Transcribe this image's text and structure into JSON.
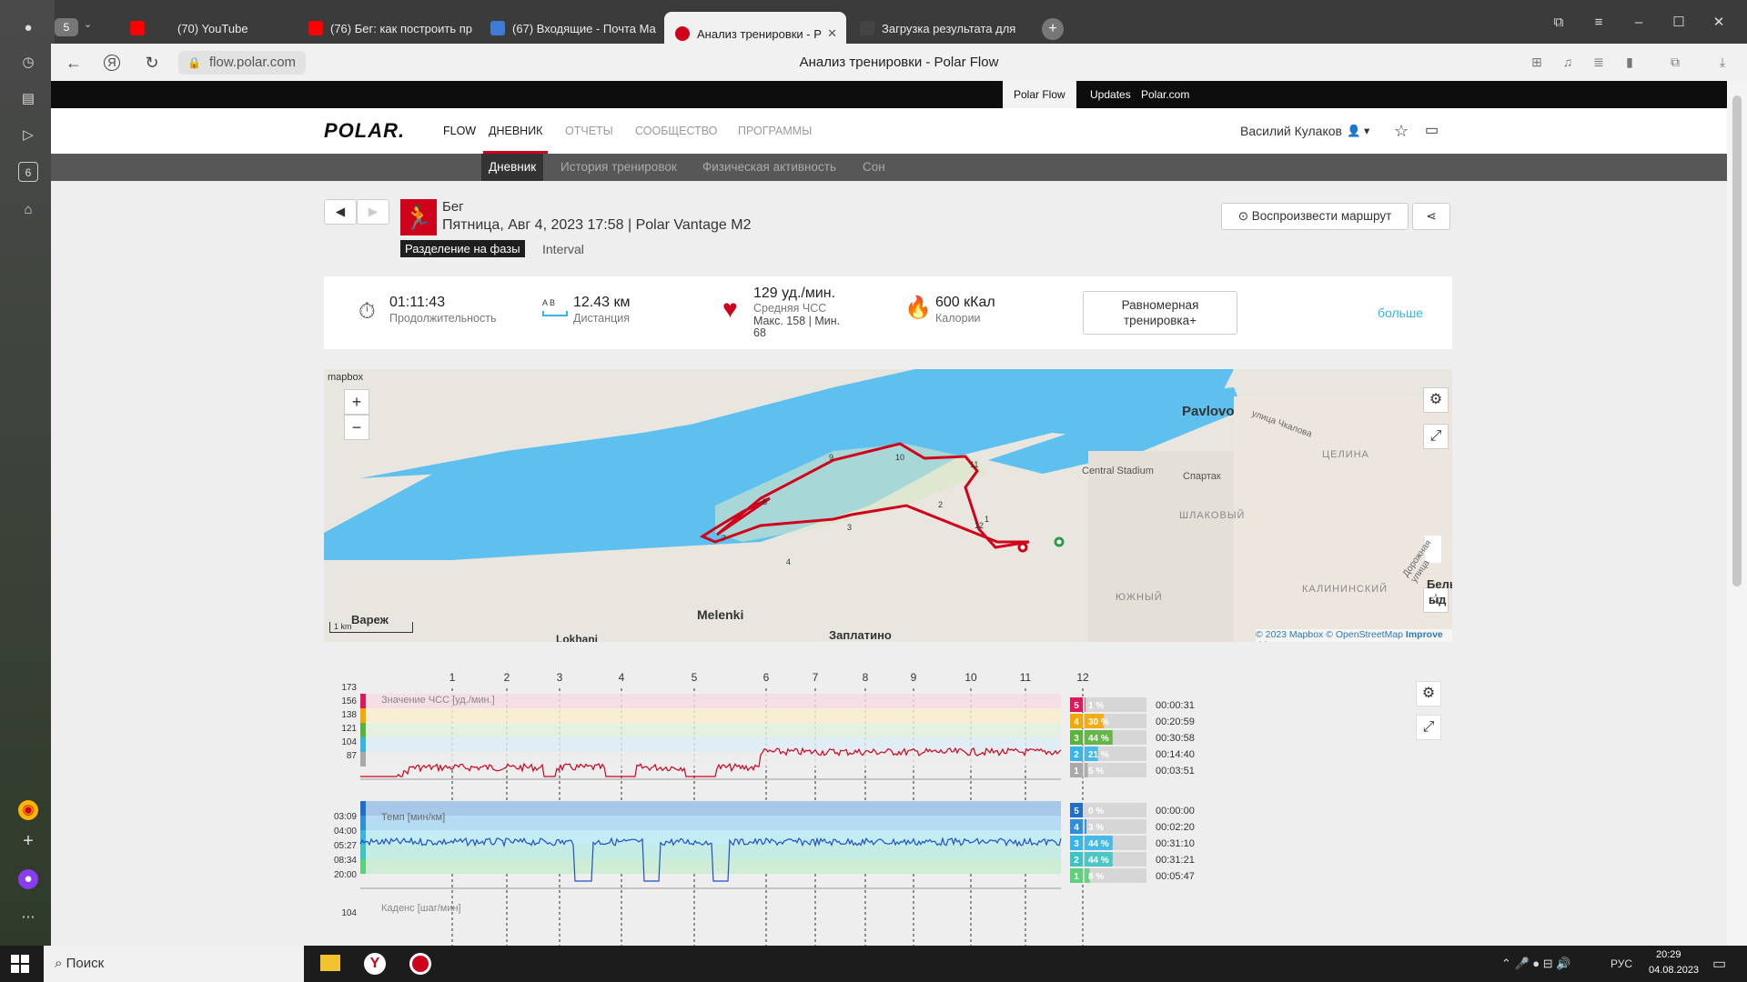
{
  "browser": {
    "tab_count": "5",
    "tabs": [
      {
        "label": "(70) YouTube",
        "color": "#ff0000"
      },
      {
        "label": "(76) Бег: как построить пр",
        "color": "#ff0000"
      },
      {
        "label": "(67) Входящие - Почта Ма",
        "color": "#3d7dd8"
      },
      {
        "label": "Анализ тренировки - P",
        "color": "#d0021b"
      },
      {
        "label": "Загрузка результата для",
        "color": "#444444"
      }
    ],
    "url": "flow.polar.com",
    "page_title": "Анализ тренировки - Polar Flow",
    "left_badge": "6"
  },
  "topbar": {
    "links": [
      "Polar Flow",
      "Updates",
      "Polar.com"
    ]
  },
  "nav": {
    "logo": "POLAR.",
    "flow": "FLOW",
    "items": [
      "ДНЕВНИК",
      "ОТЧЕТЫ",
      "СООБЩЕСТВО",
      "ПРОГРАММЫ"
    ],
    "user": "Василий Кулаков"
  },
  "subnav": [
    "Дневник",
    "История тренировок",
    "Физическая активность",
    "Сон"
  ],
  "session": {
    "sport": "Бег",
    "datetime": "Пятница, Авг 4, 2023 17:58 | Polar Vantage M2",
    "phase_chip": "Разделение на фазы",
    "phase_value": "Interval",
    "replay": "Воспроизвести маршрут"
  },
  "summary": {
    "duration": "01:11:43",
    "duration_label": "Продолжительность",
    "ab": "A B",
    "distance": "12.43 км",
    "distance_label": "Дистанция",
    "hr": "129 уд./мин.",
    "hr_label": "Средняя ЧСС",
    "hr_maxmin": "Макс. 158 | Мин.",
    "hr_min_val": "68",
    "calories": "600 кКал",
    "calories_label": "Калории",
    "benefit": "Равномерная тренировка+",
    "more": "больше"
  },
  "map": {
    "brand": "mapbox",
    "places": [
      "Pavlovo",
      "Central Stadium",
      "Спартак",
      "ЦЕЛИНА",
      "ШЛАКОВЫЙ",
      "улица Чкалова",
      "КАЛИНИНСКИЙ",
      "Дорожная улица",
      "ЮЖНЫЙ",
      "Melenki",
      "Заплатино",
      "Вареж",
      "Lokhani",
      "Бельц",
      "ыд"
    ],
    "scale": "1 km",
    "attrib": [
      "© 2023 Mapbox",
      "© OpenStreetMap",
      "Improve this map"
    ],
    "markers": [
      "1",
      "2",
      "3",
      "4",
      "7",
      "8",
      "9",
      "10",
      "11",
      "12"
    ]
  },
  "laps": [
    "1",
    "2",
    "3",
    "4",
    "5",
    "6",
    "7",
    "8",
    "9",
    "10",
    "11",
    "12"
  ],
  "hr_chart": {
    "label": "Значение ЧСС [уд./мин.]",
    "ticks": [
      "173",
      "156",
      "138",
      "121",
      "104",
      "87"
    ],
    "zones": [
      {
        "n": "5",
        "pct": "1 %",
        "time": "00:00:31",
        "color": "#e0185a"
      },
      {
        "n": "4",
        "pct": "30 %",
        "time": "00:20:59",
        "color": "#f6a800"
      },
      {
        "n": "3",
        "pct": "44 %",
        "time": "00:30:58",
        "color": "#5ab43c"
      },
      {
        "n": "2",
        "pct": "21 %",
        "time": "00:14:40",
        "color": "#36b6e6"
      },
      {
        "n": "1",
        "pct": "5 %",
        "time": "00:03:51",
        "color": "#a9a9a9"
      }
    ]
  },
  "pace_chart": {
    "label": "Темп [мин/км]",
    "ticks": [
      "03:09",
      "04:00",
      "05:27",
      "08:34",
      "20:00"
    ],
    "zones": [
      {
        "n": "5",
        "pct": "0 %",
        "time": "00:00:00",
        "color": "#1e6fc6"
      },
      {
        "n": "4",
        "pct": "3 %",
        "time": "00:02:20",
        "color": "#2f8fd8"
      },
      {
        "n": "3",
        "pct": "44 %",
        "time": "00:31:10",
        "color": "#36b6e6"
      },
      {
        "n": "2",
        "pct": "44 %",
        "time": "00:31:21",
        "color": "#3ec4c4"
      },
      {
        "n": "1",
        "pct": "8 %",
        "time": "00:05:47",
        "color": "#5cd07a"
      }
    ]
  },
  "cadence_chart": {
    "label": "Каденс [шаг/мин]",
    "tick": "104"
  },
  "taskbar": {
    "search": "Поиск",
    "lang": "РУС",
    "time": "20:29",
    "date": "04.08.2023"
  }
}
